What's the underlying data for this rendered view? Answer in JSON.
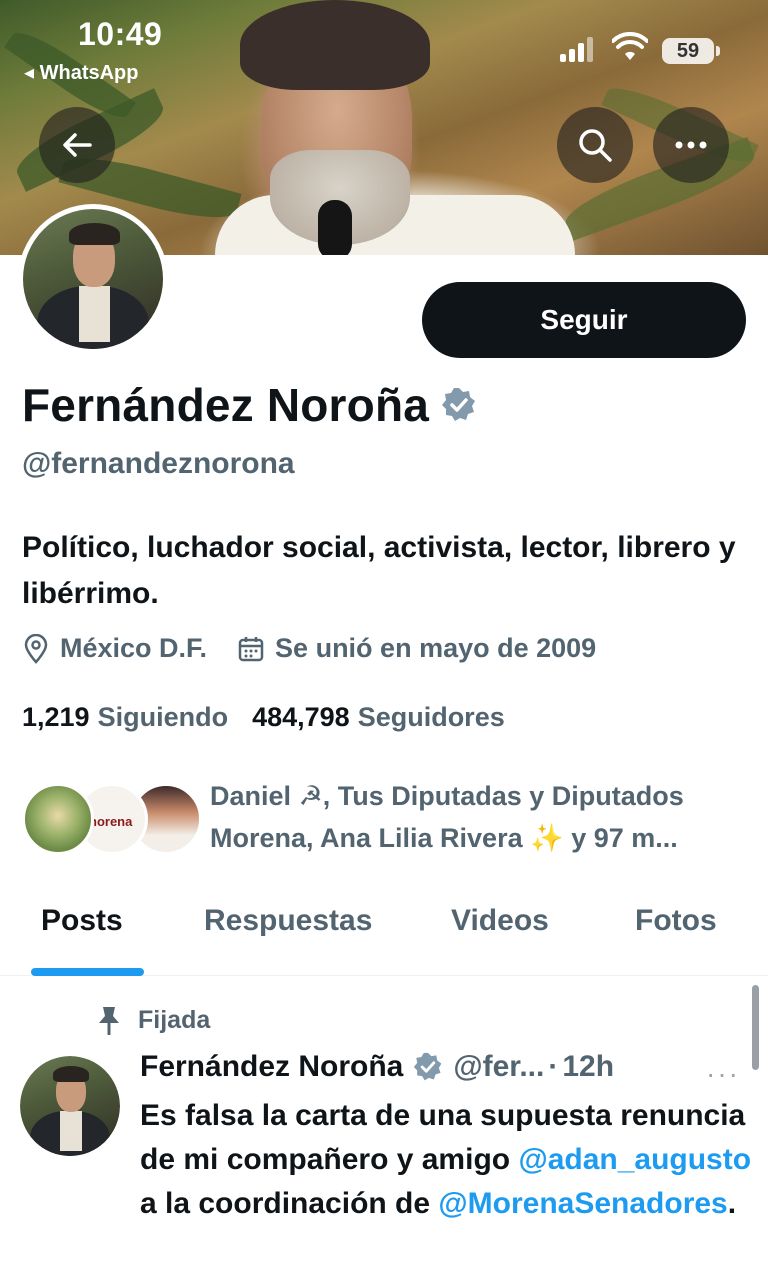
{
  "status_bar": {
    "time": "10:49",
    "back_app": "◂ WhatsApp",
    "battery": "59"
  },
  "profile": {
    "name": "Fernández Noroña",
    "handle": "@fernandeznorona",
    "bio": "Político, luchador social, activista, lector, librero y libérrimo.",
    "location": "México D.F.",
    "joined": "Se unió en mayo de 2009",
    "following_count": "1,219",
    "following_label": "Siguiendo",
    "followers_count": "484,798",
    "followers_label": "Seguidores",
    "followed_by": "Daniel ☭, Tus Diputadas y Diputados Morena, Ana Lilia Rivera ✨ y 97 m...",
    "follow_button": "Seguir",
    "verified_color": "#829aab"
  },
  "icons": {
    "back": "arrow-left-icon",
    "search": "search-icon",
    "more": "more-icon",
    "location": "location-pin-icon",
    "calendar": "calendar-icon",
    "pin": "pin-icon",
    "verified": "verified-badge-icon"
  },
  "tabs": [
    {
      "label": "Posts",
      "active": true
    },
    {
      "label": "Respuestas",
      "active": false
    },
    {
      "label": "Videos",
      "active": false
    },
    {
      "label": "Fotos",
      "active": false
    }
  ],
  "pinned_post": {
    "pinned_label": "Fijada",
    "author": "Fernández Noroña",
    "handle": "@fer...",
    "separator": "·",
    "time": "12h",
    "more": "···",
    "text_1": "Es falsa la carta de una supuesta renuncia de mi compañero y amigo ",
    "mention_1": "@adan_augusto",
    "text_2": " a la coordinación de ",
    "mention_2": "@MorenaSenadores",
    "text_3": "."
  },
  "colors": {
    "accent": "#1d9bf0",
    "text_primary": "#0f1419",
    "text_secondary": "#536471",
    "follow_button_bg": "#0f1419"
  }
}
